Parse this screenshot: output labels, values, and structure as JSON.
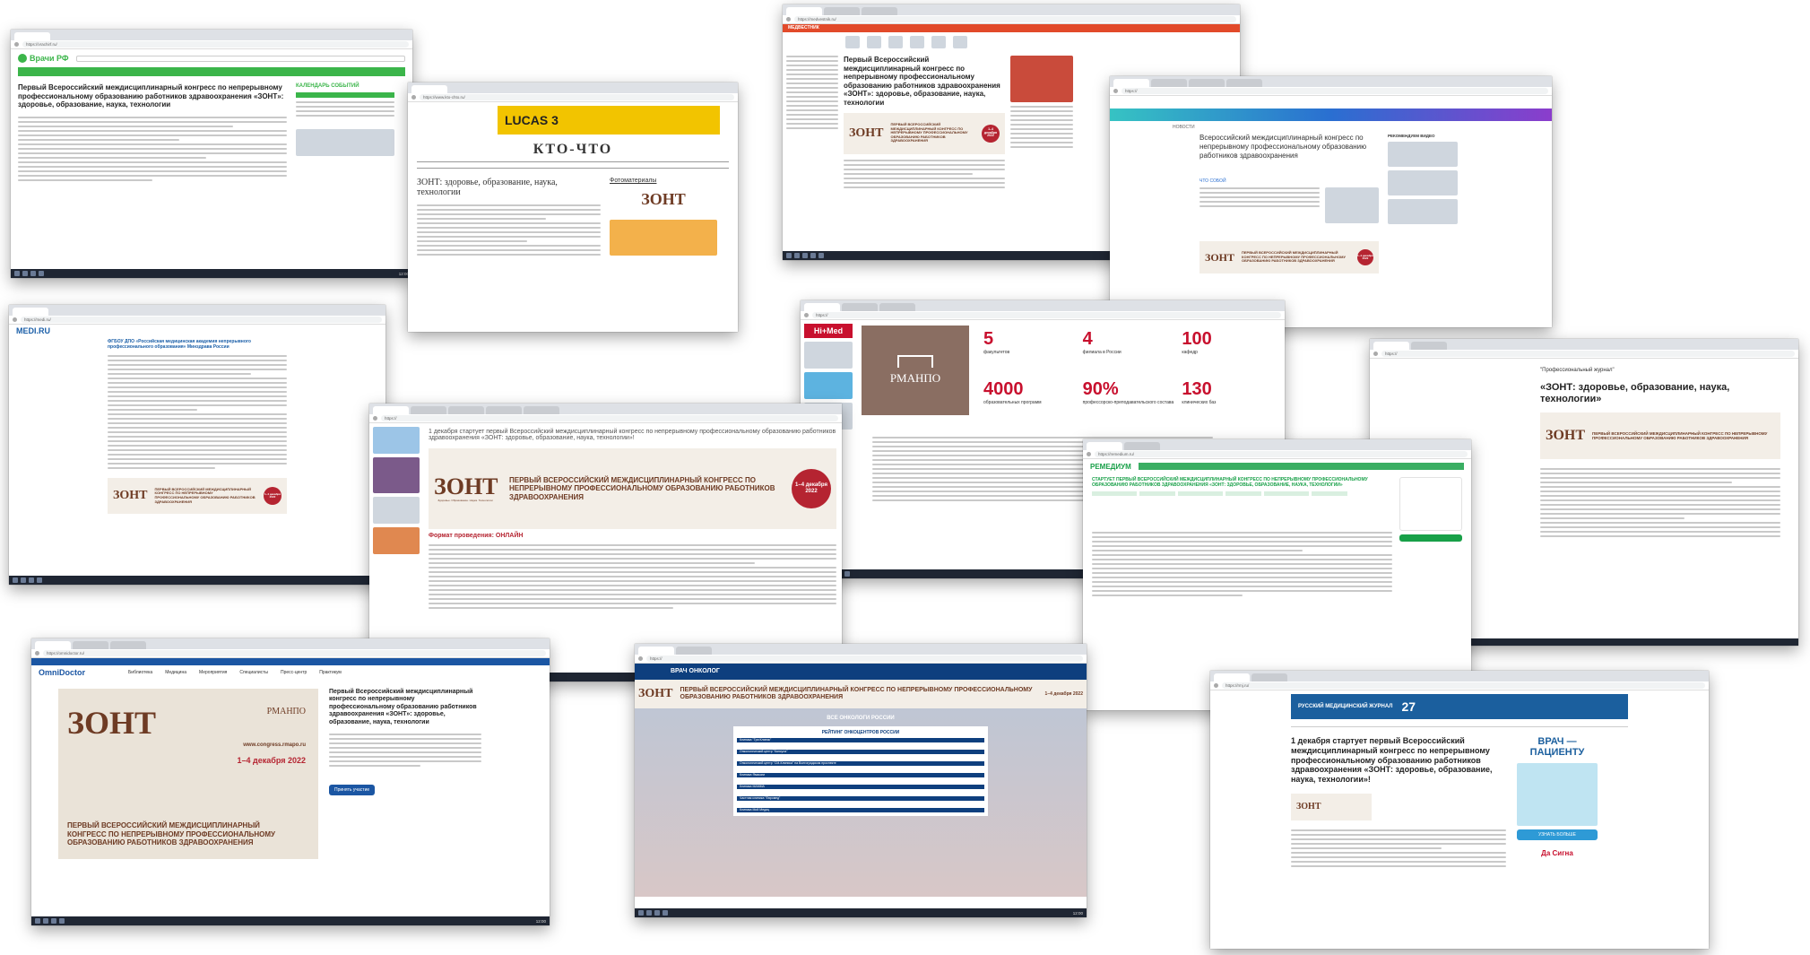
{
  "common": {
    "congress_title": "Первый Всероссийский междисциплинарный конгресс по непрерывному профессиональному образованию работников здравоохранения «ЗОНТ»: здоровье, образование, наука, технологии",
    "congress_title_short": "«ЗОНТ»: здоровье, образование, наука, технологии»",
    "zont_word": "ЗОНТ",
    "zont_tagline": "Здоровье. Образование. Наука. Технологии",
    "banner_upper": "ПЕРВЫЙ ВСЕРОССИЙСКИЙ МЕЖДИСЦИПЛИНАРНЫЙ КОНГРЕСС ПО НЕПРЕРЫВНОМУ ПРОФЕССИОНАЛЬНОМУ ОБРАЗОВАНИЮ РАБОТНИКОВ ЗДРАВООХРАНЕНИЯ",
    "dates": "1–4 декабря 2022",
    "site": "www.congress.rmapo.ru",
    "rmanpo": "РМАНПО",
    "start_text": "1 декабря стартует первый Всероссийский междисциплинарный конгресс по непрерывному профессиональному образованию работников здравоохранения «ЗОНТ: здоровье, образование, наука, технологии»!"
  },
  "shot1": {
    "site": "Врачи РФ",
    "calendar": "КАЛЕНДАРЬ СОБЫТИЙ",
    "headline": "Первый Всероссийский междисциплинарный конгресс по непрерывному профессиональному образованию работников здравоохранения «ЗОНТ»: здоровье, образование, наука, технологии"
  },
  "shot2": {
    "ad": "LUCAS 3",
    "site": "КТО-ЧТО",
    "headline": "ЗОНТ: здоровье, образование, наука, технологии",
    "side_label": "Фотоматериалы"
  },
  "shot3": {
    "site": "МЕДВЕСТНИК",
    "headline": "Первый Всероссийский междисциплинарный конгресс по непрерывному профессиональному образованию работников здравоохранения «ЗОНТ»: здоровье, образование, наука, технологии"
  },
  "shot4": {
    "section": "НОВОСТИ",
    "headline": "Всероссийский междисциплинарный конгресс по непрерывному профессиональному образованию работников здравоохранения",
    "side": "РЕКОМЕНДУЕМ ВИДЕО",
    "what": "ЧТО СОБОЙ"
  },
  "shot5": {
    "site": "MEDI.RU",
    "headline": "ФГБОУ ДПО «Российская медицинская академия непрерывного профессионального образования» Минздрава России"
  },
  "shot6": {
    "headline": "1 декабря стартует первый Всероссийский междисциплинарный конгресс по непрерывному профессиональному образованию работников здравоохранения «ЗОНТ: здоровье, образование, наука, технологии»!",
    "format": "Формат проведения: ОНЛАЙН",
    "circle": "1–4 декабря 2022"
  },
  "shot7": {
    "himed": "Hi+Med",
    "stats": [
      {
        "num": "5",
        "label": "факультетов"
      },
      {
        "num": "4",
        "филиала": "",
        "label": "филиала в России"
      },
      {
        "num": "100",
        "label": "кафедр"
      },
      {
        "num": "4000",
        "label": "образовательных программ"
      },
      {
        "num": "90%",
        "label": "профессорско-преподавательского состава"
      },
      {
        "num": "130",
        "label": "клинических баз"
      }
    ]
  },
  "shot8": {
    "site": "РЕМЕДИУМ",
    "headline": "СТАРТУЕТ ПЕРВЫЙ ВСЕРОССИЙСКИЙ МЕЖДИСЦИПЛИНАРНЫЙ КОНГРЕСС ПО НЕПРЕРЫВНОМУ ПРОФЕССИОНАЛЬНОМУ ОБРАЗОВАНИЮ РАБОТНИКОВ ЗДРАВООХРАНЕНИЯ «ЗОНТ: ЗДОРОВЬЕ, ОБРАЗОВАНИЕ, НАУКА, ТЕХНОЛОГИИ»"
  },
  "shot9": {
    "journal": "\"Профессиональный журнал\"",
    "headline": "«ЗОНТ: здоровье, образование, наука, технологии»"
  },
  "shot10": {
    "site": "OmniDoctor",
    "nav": [
      "Библиотека",
      "Медицина",
      "Мероприятия",
      "Специалисты",
      "Пресс-центр",
      "Практикум"
    ],
    "headline": "Первый Всероссийский междисциплинарный конгресс по непрерывному профессиональному образованию работников здравоохранения «ЗОНТ»: здоровье, образование, наука, технологии",
    "button": "Принять участие"
  },
  "shot11": {
    "site": "ВРАЧ ОНКОЛОГ",
    "section": "ВСЕ ОНКОЛОГИ РОССИИ",
    "rating": "РЕЙТИНГ ОНКОЦЕНТРОВ РОССИИ",
    "rows": [
      "Клиника \"Три Клиник\"",
      "Онкологический центр \"Капсула\"",
      "Онкологический центр \"СМ-Клиника\" на Волгоградском проспекте",
      "Клиника Ямакаги",
      "Клиника МАММА",
      "Частная клиника \"Евромед\"",
      "Клиника Мой Медиц"
    ]
  },
  "shot12": {
    "site": "РУССКИЙ МЕДИЦИНСКИЙ ЖУРНАЛ",
    "years": "27",
    "headline": "1 декабря стартует первый Всероссийский междисциплинарный конгресс по непрерывному профессиональному образованию работников здравоохранения «ЗОНТ: здоровье, образование, наука, технологии»!",
    "ad_title": "ВРАЧ — ПАЦИЕНТУ",
    "ad_button": "УЗНАТЬ БОЛЬШЕ",
    "ad_footer": "Да Сигна"
  }
}
